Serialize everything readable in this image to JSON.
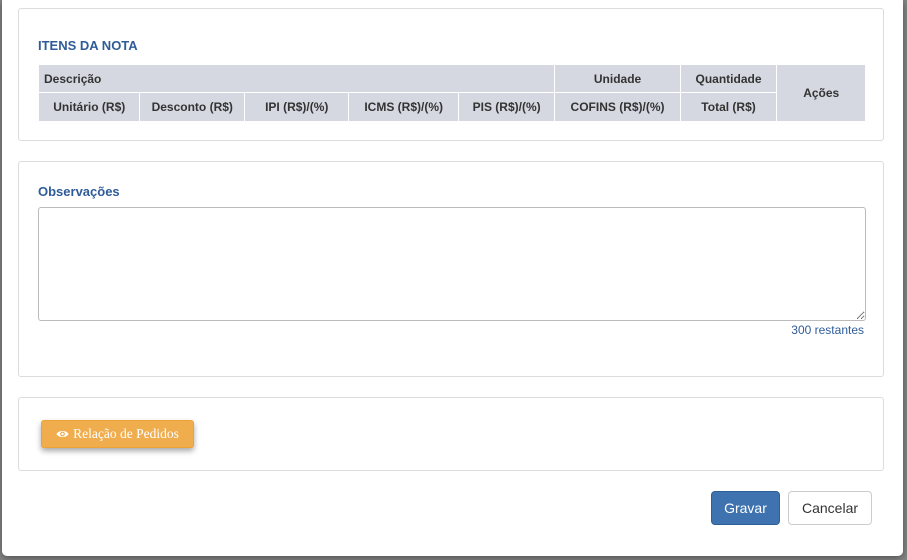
{
  "itens": {
    "title": "ITENS DA NOTA",
    "header_row1": {
      "descricao": "Descrição",
      "unidade": "Unidade",
      "quantidade": "Quantidade",
      "acoes": "Ações"
    },
    "header_row2": [
      "Unitário (R$)",
      "Desconto (R$)",
      "IPI (R$)/(%)",
      "ICMS (R$)/(%)",
      "PIS (R$)/(%)",
      "COFINS (R$)/(%)",
      "Total (R$)"
    ]
  },
  "observacoes": {
    "title": "Observações",
    "value": "",
    "remaining": "300 restantes"
  },
  "pedidos": {
    "button_label": "Relação de Pedidos",
    "icon": "eye-icon"
  },
  "footer": {
    "save_label": "Gravar",
    "cancel_label": "Cancelar"
  },
  "colors": {
    "primary": "#3f73b0",
    "warning": "#f0ad4e",
    "title": "#2f5c99",
    "table_header": "#d5d8e0"
  }
}
